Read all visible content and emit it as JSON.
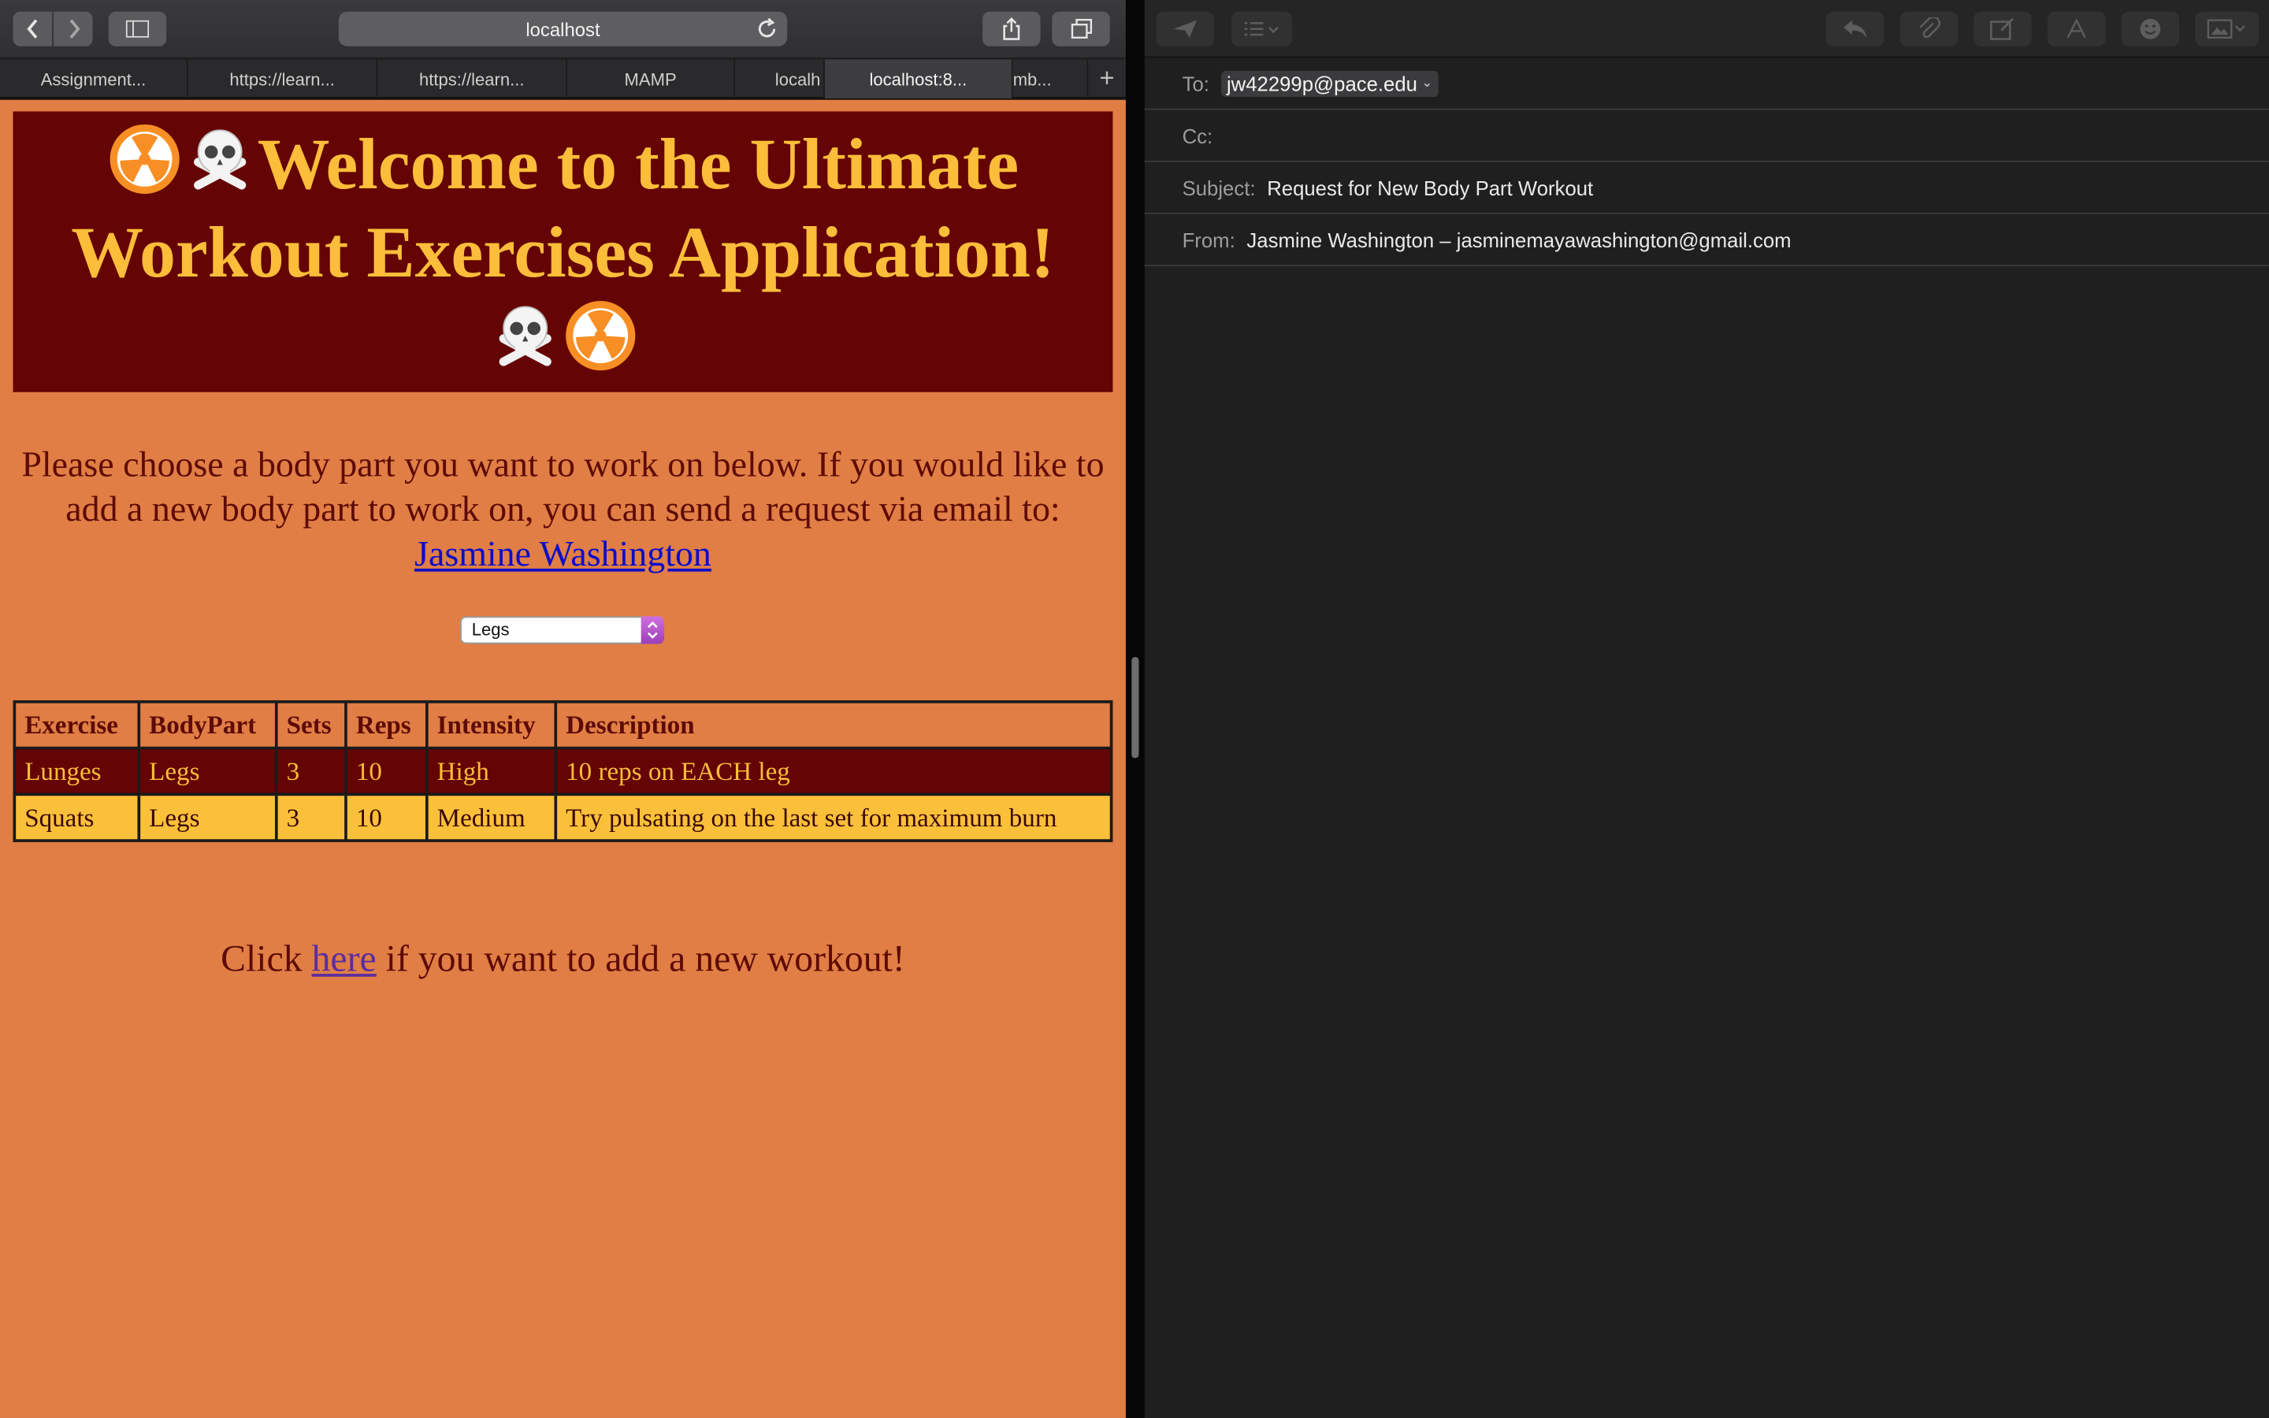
{
  "browser": {
    "address": "localhost",
    "tabs": [
      {
        "label": "Assignment..."
      },
      {
        "label": "https://learn..."
      },
      {
        "label": "https://learn..."
      },
      {
        "label": "MAMP"
      },
      {
        "label": "localh"
      },
      {
        "label": "localhost:8..."
      },
      {
        "label": "mb..."
      }
    ],
    "new_tab": "+"
  },
  "page": {
    "hero_title": "Welcome to the Ultimate Workout Exercises Application!",
    "intro_text": "Please choose a body part you want to work on below. If you would like to add a new body part to work on, you can send a request via email to:",
    "contact_link": "Jasmine Washington",
    "select_value": "Legs",
    "table": {
      "headers": [
        "Exercise",
        "BodyPart",
        "Sets",
        "Reps",
        "Intensity",
        "Description"
      ],
      "rows": [
        [
          "Lunges",
          "Legs",
          "3",
          "10",
          "High",
          "10 reps on EACH leg"
        ],
        [
          "Squats",
          "Legs",
          "3",
          "10",
          "Medium",
          "Try pulsating on the last set for maximum burn"
        ]
      ]
    },
    "add_prefix": "Click",
    "add_link": "here",
    "add_suffix": "if you want to add a new workout!"
  },
  "mail": {
    "to_label": "To:",
    "to_value": "jw42299p@pace.edu",
    "cc_label": "Cc:",
    "subject_label": "Subject:",
    "subject_value": "Request for New Body Part Workout",
    "from_label": "From:",
    "from_value": "Jasmine Washington – jasminemayawashington@gmail.com"
  }
}
